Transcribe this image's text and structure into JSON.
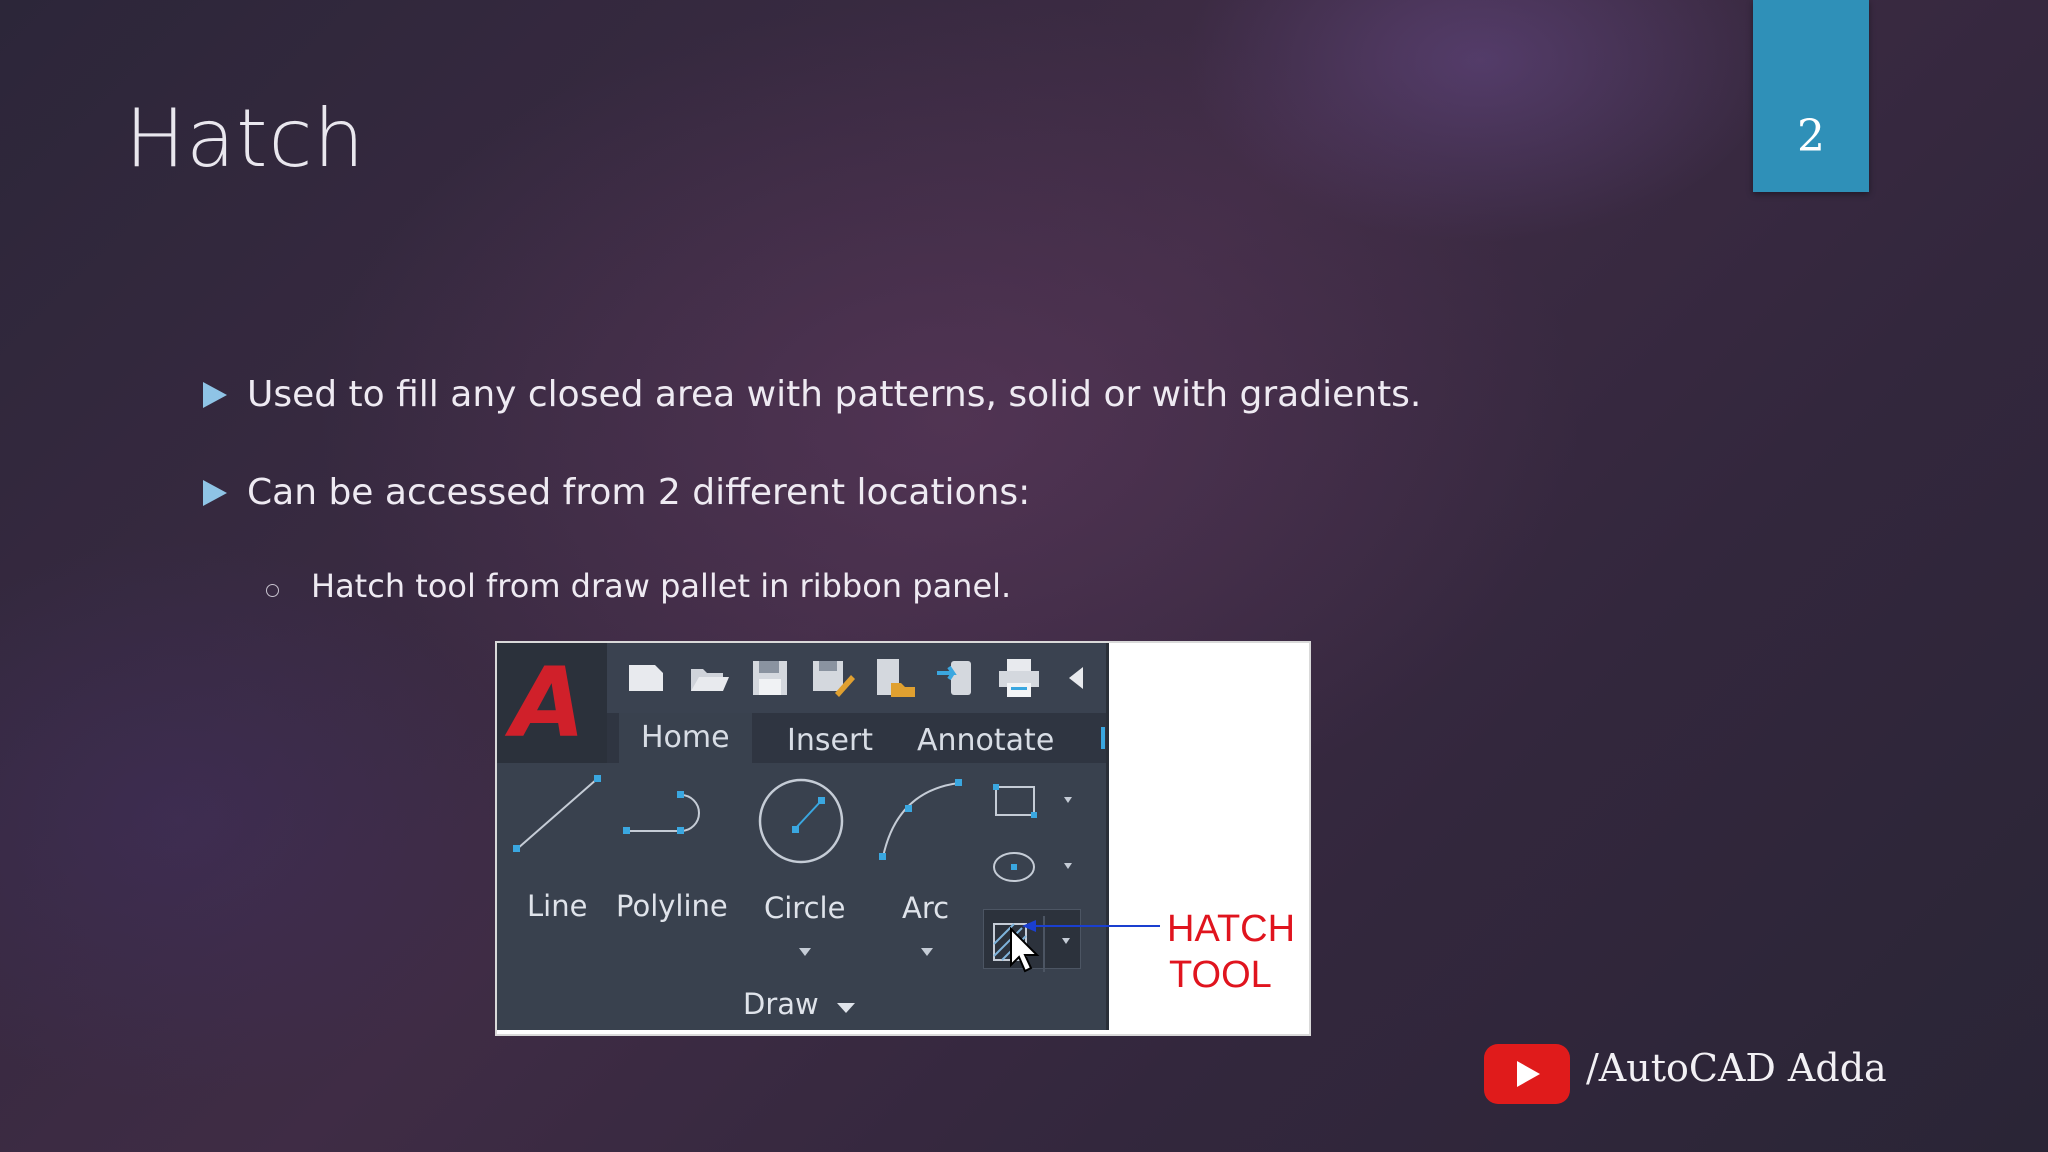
{
  "slide": {
    "title": "Hatch",
    "number": "2",
    "bullets": [
      "Used to fill any closed area with patterns, solid or with gradients.",
      "Can be accessed from 2 different locations:"
    ],
    "sub_bullets": [
      "Hatch tool from draw pallet in ribbon panel."
    ]
  },
  "figure": {
    "logo": "A",
    "tabs": [
      "Home",
      "Insert",
      "Annotate"
    ],
    "active_tab": "Home",
    "tools": [
      "Line",
      "Polyline",
      "Circle",
      "Arc"
    ],
    "panel_title": "Draw",
    "annotation": [
      "HATCH",
      "TOOL"
    ]
  },
  "watermark": {
    "text": "/AutoCAD Adda"
  },
  "colors": {
    "accent": "#2f90b8",
    "bullet": "#8fc4e6",
    "annotation": "#e0141e",
    "youtube": "#e01b1b"
  }
}
